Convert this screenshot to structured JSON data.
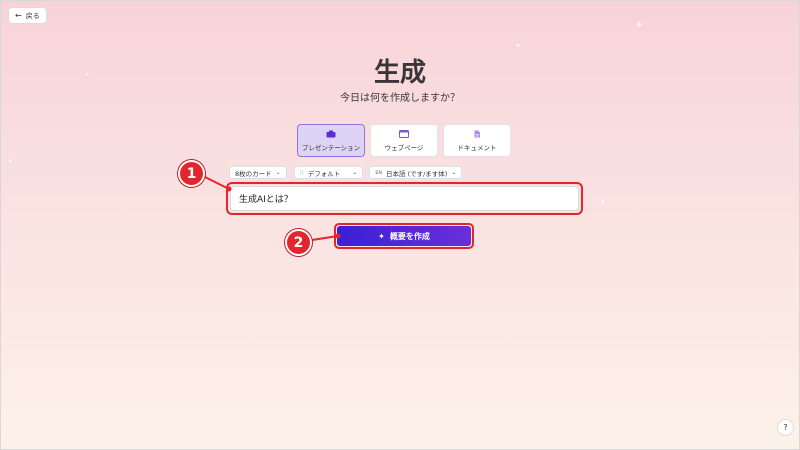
{
  "header": {
    "back_label": "戻る",
    "title": "生成",
    "subtitle": "今日は何を作成しますか？"
  },
  "content_types": [
    {
      "label": "プレゼンテーション",
      "icon": "presentation-icon",
      "selected": true
    },
    {
      "label": "ウェブページ",
      "icon": "webpage-icon",
      "selected": false
    },
    {
      "label": "ドキュメント",
      "icon": "document-icon",
      "selected": false
    }
  ],
  "options": {
    "card_count": "8枚のカード",
    "theme_glyph": "::",
    "theme": "デフォルト",
    "language_glyph": "ᴇɴ",
    "language": "日本語 (です/ます体)"
  },
  "prompt": {
    "value": "生成AIとは？"
  },
  "generate_button": {
    "icon": "sparkle-icon",
    "label": "概要を作成"
  },
  "annotations": {
    "marker_1": "1",
    "marker_2": "2",
    "color": "#e3252c"
  },
  "help": {
    "label": "?"
  },
  "colors": {
    "accent": "#5b2bd8",
    "selected_tab_bg": "#ddd3f5",
    "annotation_red": "#e3252c"
  }
}
